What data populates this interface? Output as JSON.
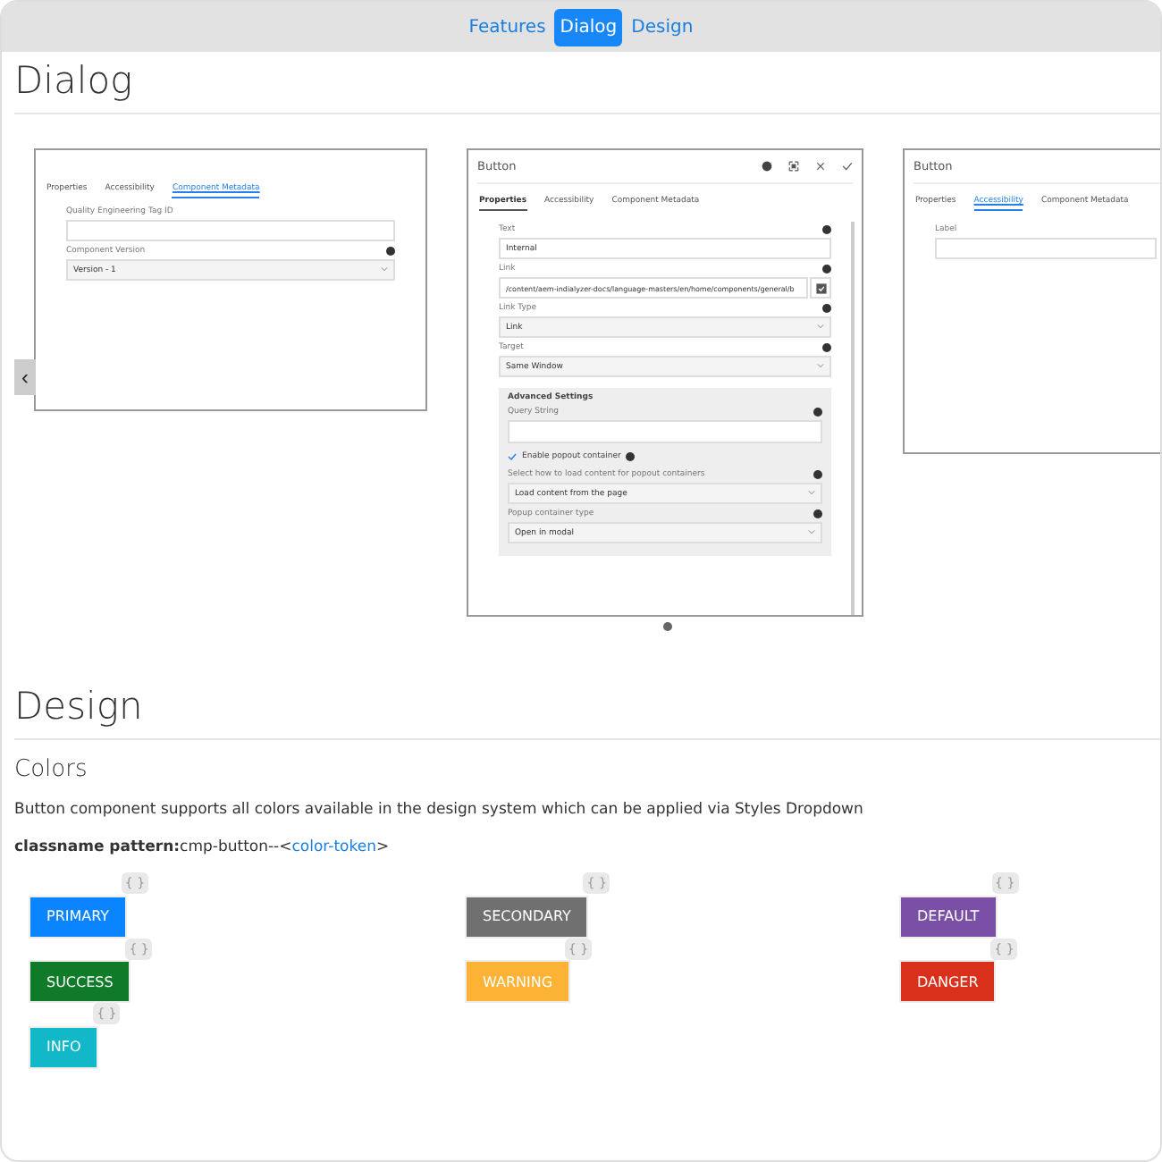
{
  "top_nav": [
    {
      "label": "Features",
      "selected": false
    },
    {
      "label": "Dialog",
      "selected": true
    },
    {
      "label": "Design",
      "selected": false
    }
  ],
  "dialog_section": {
    "heading": "Dialog",
    "carousel": {
      "prev_button": "‹",
      "slides": [
        {
          "tabs": [
            {
              "label": "Properties",
              "selected": false
            },
            {
              "label": "Accessibility",
              "selected": false
            },
            {
              "label": "Component Metadata",
              "selected": true
            }
          ],
          "fields": [
            {
              "kind": "text",
              "label": "Quality Engineering Tag ID",
              "info": false
            },
            {
              "kind": "select",
              "label": "Component Version",
              "info": true,
              "value": "Version - 1"
            }
          ]
        },
        {
          "title": "Button",
          "header_icons": true,
          "tabs": [
            {
              "label": "Properties",
              "selected": true
            },
            {
              "label": "Accessibility",
              "selected": false
            },
            {
              "label": "Component Metadata",
              "selected": false
            }
          ],
          "fields": [
            {
              "kind": "text",
              "label": "Text",
              "info": true,
              "value": "Internal"
            },
            {
              "kind": "link",
              "label": "Link",
              "info": true,
              "value": "/content/aem-indialyzer-docs/language-masters/en/home/components/general/b"
            },
            {
              "kind": "select",
              "label": "Link Type",
              "info": true,
              "value": "Link"
            },
            {
              "kind": "select",
              "label": "Target",
              "info": true,
              "value": "Same Window"
            },
            {
              "kind": "group",
              "label": "Advanced Settings",
              "children": [
                {
                  "kind": "text",
                  "label": "Query String",
                  "info": true
                },
                {
                  "kind": "checkbox",
                  "label": "Enable popout container",
                  "info": true,
                  "checked": true
                },
                {
                  "kind": "select",
                  "label": "Select how to load content for popout containers",
                  "info": true,
                  "value": "Load content from the page"
                },
                {
                  "kind": "select",
                  "label": "Popup container type",
                  "info": true,
                  "value": "Open in modal"
                }
              ]
            }
          ]
        },
        {
          "title": "Button",
          "header_icons": false,
          "tabs": [
            {
              "label": "Properties",
              "selected": false
            },
            {
              "label": "Accessibility",
              "selected": true
            },
            {
              "label": "Component Metadata",
              "selected": false
            }
          ],
          "fields": [
            {
              "kind": "text",
              "label": "Label",
              "info": false
            }
          ]
        }
      ],
      "dots": [
        {
          "selected": true
        }
      ]
    }
  },
  "design_section": {
    "heading": "Design",
    "subheading": "Colors",
    "description": "Button component supports all colors available in the design system which can be applied via Styles Dropdown",
    "pattern_label": "classname pattern:",
    "pattern_text": "cmp-button--<",
    "pattern_link": "color-token",
    "pattern_end": ">",
    "color_buttons": [
      {
        "label": "PRIMARY",
        "color": "#0a84ff",
        "badge": "{ }"
      },
      {
        "label": "SECONDARY",
        "color": "#707070",
        "badge": "{ }"
      },
      {
        "label": "DEFAULT",
        "color": "#7b4fa6",
        "badge": "{ }"
      },
      {
        "label": "SUCCESS",
        "color": "#0f7b29",
        "badge": "{ }"
      },
      {
        "label": "WARNING",
        "color": "#fbb235",
        "badge": "{ }"
      },
      {
        "label": "DANGER",
        "color": "#d9301c",
        "badge": "{ }"
      },
      {
        "label": "INFO",
        "color": "#12b8c8",
        "badge": "{ }"
      }
    ]
  }
}
